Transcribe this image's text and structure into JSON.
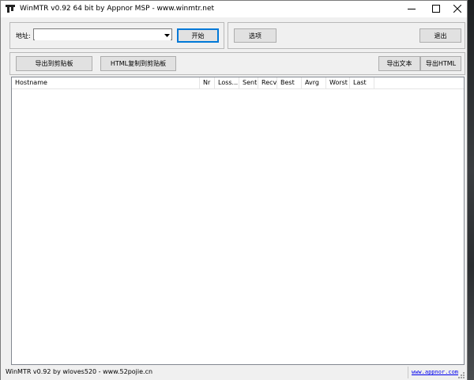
{
  "window": {
    "title": "WinMTR v0.92 64 bit by Appnor MSP - www.winmtr.net",
    "icon": "winmtr-app-icon"
  },
  "address": {
    "label": "地址:",
    "value": "",
    "placeholder": ""
  },
  "buttons": {
    "start": "开始",
    "options": "选项",
    "exit": "退出",
    "copy_text": "导出到剪贴板",
    "copy_html": "HTML复制到剪贴板",
    "export_text": "导出文本",
    "export_html": "导出HTML"
  },
  "table": {
    "columns": [
      "Hostname",
      "Nr",
      "Loss...",
      "Sent",
      "Recv",
      "Best",
      "Avrg",
      "Worst",
      "Last"
    ],
    "rows": []
  },
  "statusbar": {
    "text": "WinMTR v0.92 by wloves520 - www.52pojie.cn",
    "link": "www.appnor.com"
  },
  "colors": {
    "window_bg": "#f0f0f0",
    "default_button_border": "#0078d7",
    "link": "#0000ee"
  }
}
